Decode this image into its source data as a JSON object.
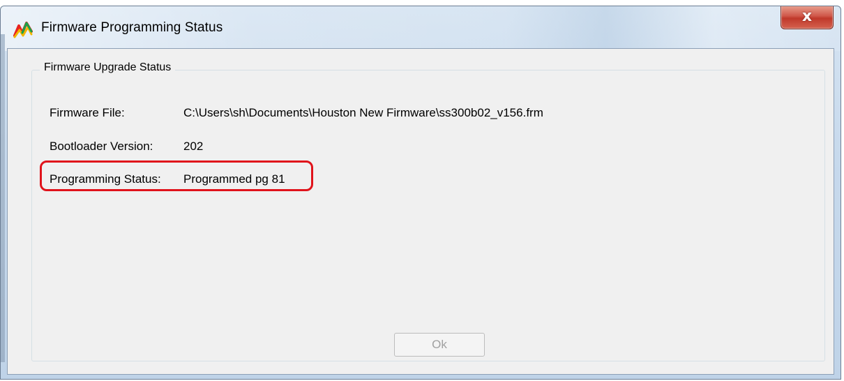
{
  "window": {
    "title": "Firmware Programming Status",
    "close_label": "x",
    "icon": "app-chart-icon"
  },
  "group": {
    "title": "Firmware Upgrade Status"
  },
  "fields": {
    "firmware_file": {
      "label": "Firmware File:",
      "value": "C:\\Users\\sh\\Documents\\Houston New Firmware\\ss300b02_v156.frm"
    },
    "bootloader_version": {
      "label": "Bootloader Version:",
      "value": "202"
    },
    "programming_status": {
      "label": "Programming Status:",
      "value": "Programmed pg 81"
    }
  },
  "buttons": {
    "ok_label": "Ok"
  },
  "colors": {
    "highlight_box": "#e0131b",
    "close_button": "#c0392b"
  }
}
